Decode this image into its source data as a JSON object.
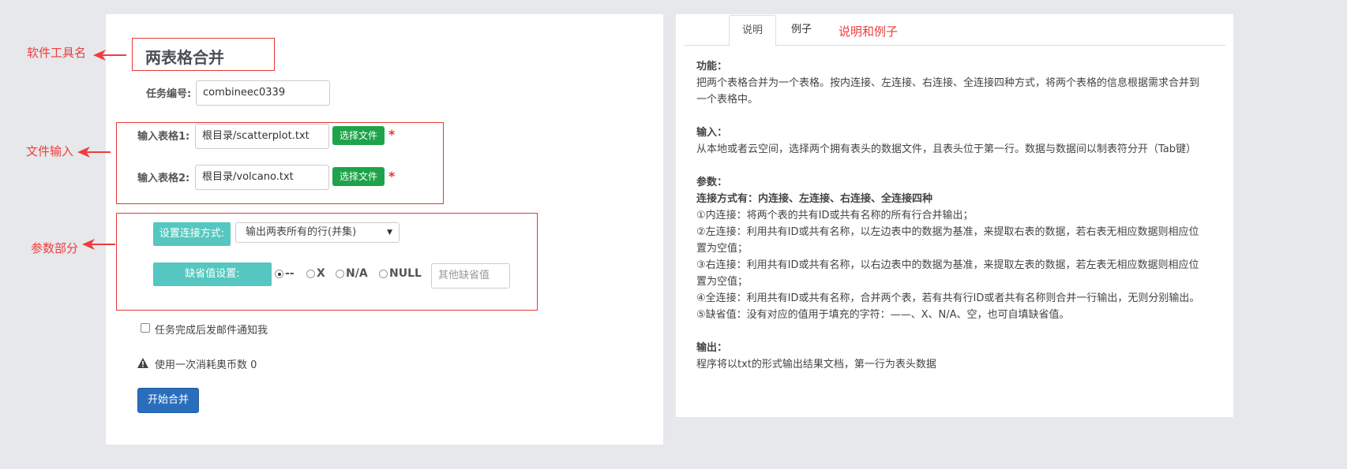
{
  "annotations": {
    "tool_name": "软件工具名",
    "file_input": "文件输入",
    "params": "参数部分",
    "desc_and_example": "说明和例子"
  },
  "form": {
    "title": "两表格合并",
    "task_id_label": "任务编号:",
    "task_id_value": "combineec0339",
    "table1_label": "输入表格1:",
    "table1_value": "根目录/scatterplot.txt",
    "table2_label": "输入表格2:",
    "table2_value": "根目录/volcano.txt",
    "choose_file": "选择文件",
    "required_mark": "*",
    "join_label": "设置连接方式:",
    "join_selected": "输出两表所有的行(并集)",
    "missing_label": "缺省值设置:",
    "missing_options": [
      "--",
      "X",
      "N/A",
      "NULL"
    ],
    "missing_selected": "--",
    "other_missing_placeholder": "其他缺省值",
    "email_notify": "任务完成后发邮件通知我",
    "cost_note": "使用一次消耗奥币数 0",
    "start_button": "开始合并"
  },
  "tabs": {
    "items": [
      "说明",
      "例子"
    ],
    "active": "说明"
  },
  "doc": {
    "func_title": "功能：",
    "func_body": "把两个表格合并为一个表格。按内连接、左连接、右连接、全连接四种方式，将两个表格的信息根据需求合并到一个表格中。",
    "input_title": "输入：",
    "input_body": "从本地或者云空间，选择两个拥有表头的数据文件，且表头位于第一行。数据与数据间以制表符分开（Tab键）",
    "param_title": "参数：",
    "param_sub": "连接方式有：内连接、左连接、右连接、全连接四种",
    "param_1": "①内连接：将两个表的共有ID或共有名称的所有行合并输出；",
    "param_2": "②左连接：利用共有ID或共有名称，以左边表中的数据为基准，来提取右表的数据，若右表无相应数据则相应位置为空值；",
    "param_3": "③右连接：利用共有ID或共有名称，以右边表中的数据为基准，来提取左表的数据，若左表无相应数据则相应位置为空值；",
    "param_4": "④全连接：利用共有ID或共有名称，合并两个表，若有共有行ID或者共有名称则合并一行输出，无则分别输出。",
    "param_5": "⑤缺省值：没有对应的值用于填充的字符：——、X、N/A、空，也可自填缺省值。",
    "output_title": "输出：",
    "output_body": "程序将以txt的形式输出结果文档，第一行为表头数据"
  },
  "colors": {
    "annotation_red": "#f03c3c",
    "file_button_green": "#1ea34a",
    "teal": "#55c7c0",
    "primary_blue": "#2a6ebb"
  }
}
